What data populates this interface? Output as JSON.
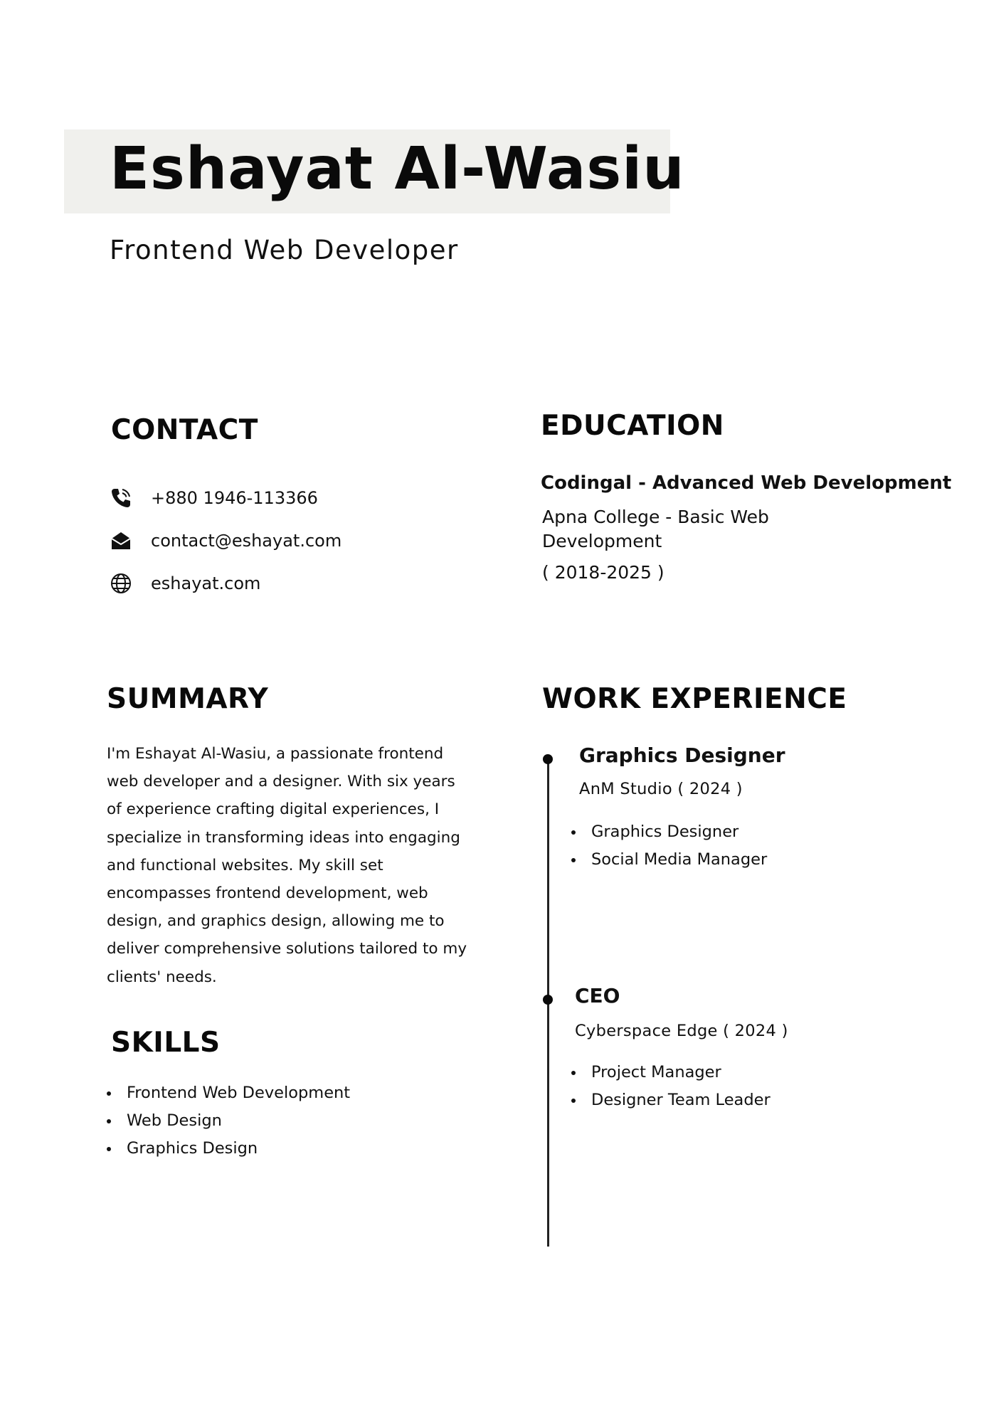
{
  "header": {
    "name": "Eshayat Al-Wasiu",
    "role": "Frontend Web Developer"
  },
  "contact": {
    "heading": "CONTACT",
    "phone": "+880 1946-113366",
    "email": "contact@eshayat.com",
    "website": "eshayat.com",
    "icons": [
      "phone-icon",
      "envelope-icon",
      "globe-icon"
    ]
  },
  "education": {
    "heading": "EDUCATION",
    "primary": "Codingal - Advanced Web Development",
    "secondary": "Apna College - Basic Web Development",
    "years": "( 2018-2025 )"
  },
  "summary": {
    "heading": "SUMMARY",
    "text": "I'm Eshayat Al-Wasiu, a passionate frontend web developer and a designer. With six years of experience crafting digital experiences, I specialize in transforming ideas into engaging and functional websites. My skill set encompasses frontend development, web design, and graphics design, allowing me to deliver comprehensive solutions tailored to my clients' needs."
  },
  "skills": {
    "heading": "SKILLS",
    "items": [
      "Frontend Web Development",
      "Web Design",
      "Graphics Design"
    ]
  },
  "work": {
    "heading": "WORK EXPERIENCE",
    "jobs": [
      {
        "title": "Graphics Designer",
        "org": "AnM Studio ( 2024 )",
        "duties": [
          "Graphics Designer",
          "Social Media Manager"
        ]
      },
      {
        "title": "CEO",
        "org": "Cyberspace Edge ( 2024 )",
        "duties": [
          "Project Manager",
          "Designer Team Leader"
        ]
      }
    ]
  },
  "colors": {
    "name_band": "#f0f0ed",
    "text": "#111111"
  }
}
